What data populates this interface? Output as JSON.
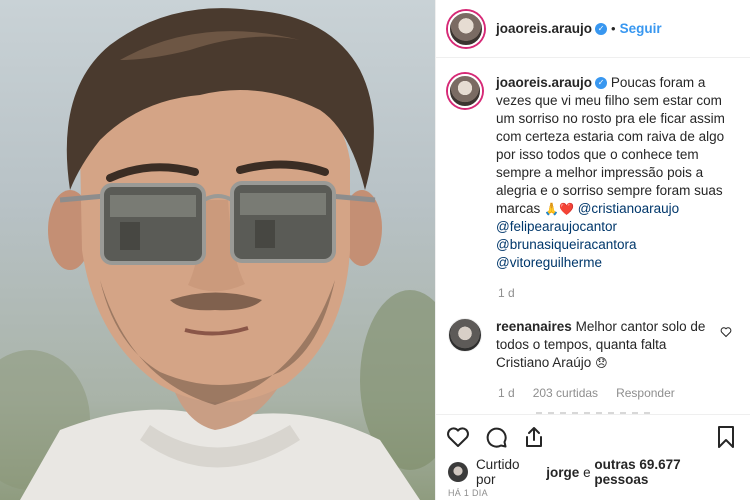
{
  "colors": {
    "accent": "#3897f0",
    "text": "#262626",
    "muted": "#8e8e8e",
    "mention": "#00376b",
    "heart": "#ed4956"
  },
  "header": {
    "username": "joaoreis.araujo",
    "separator": "•",
    "follow_label": "Seguir"
  },
  "caption": {
    "username": "joaoreis.araujo",
    "text": "Poucas foram a vezes que vi meu filho sem estar com um sorriso no rosto pra ele ficar assim com certeza estaria com raiva de algo por isso todos que o conhece tem sempre a melhor impressão pois a alegria e o sorriso sempre foram suas marcas",
    "emojis": "🙏❤️",
    "mentions": [
      "@cristianoaraujo",
      "@felipearaujocantor",
      "@brunasiqueiracantora",
      "@vitoreguilherme"
    ],
    "age": "1 d"
  },
  "comment": {
    "username": "reenanaires",
    "text": "Melhor cantor solo de todos o tempos, quanta falta Cristiano Araújo",
    "emoji": "😞",
    "age": "1 d",
    "likes": "203 curtidas",
    "reply_label": "Responder"
  },
  "actions": {
    "like_icon": "heart-icon",
    "comment_icon": "comment-icon",
    "share_icon": "share-icon",
    "save_icon": "bookmark-icon"
  },
  "likes": {
    "prefix": "Curtido por",
    "user": "jorge",
    "middle": "e",
    "others": "outras 69.677 pessoas"
  },
  "timestamp": "HÁ 1 DIA"
}
